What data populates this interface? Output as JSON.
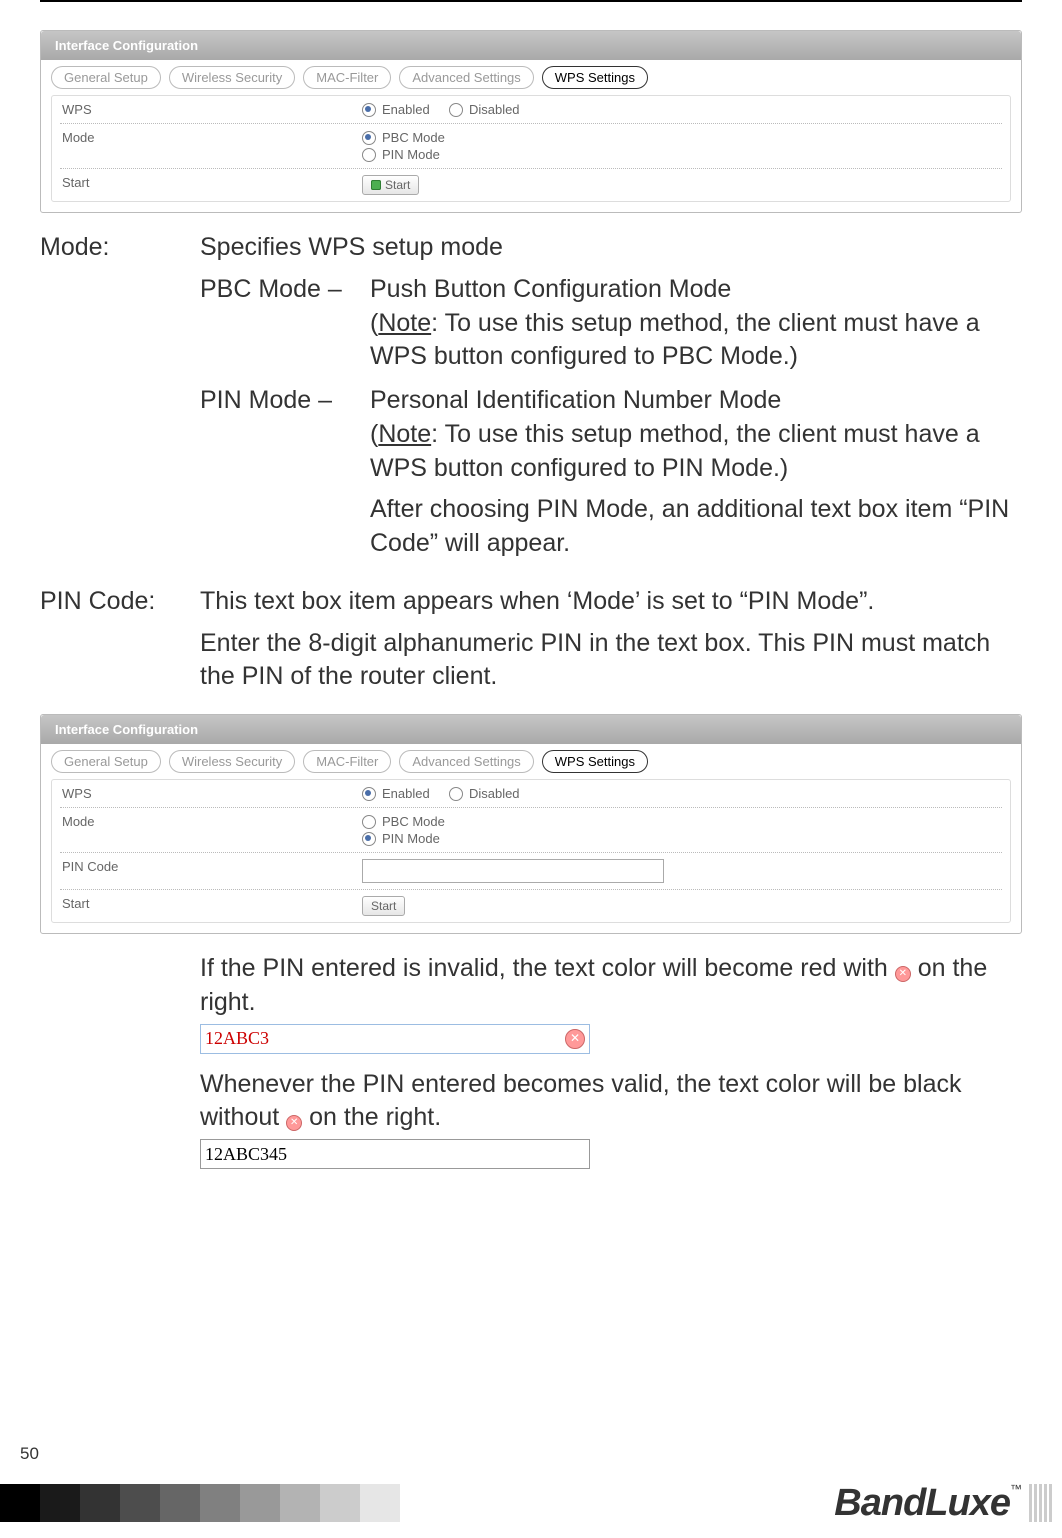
{
  "panel1": {
    "title": "Interface Configuration",
    "tabs": [
      "General Setup",
      "Wireless Security",
      "MAC-Filter",
      "Advanced Settings",
      "WPS Settings"
    ],
    "activeTab": 4,
    "rows": {
      "wps": {
        "label": "WPS",
        "opt_enabled": "Enabled",
        "opt_disabled": "Disabled",
        "selected": "enabled"
      },
      "mode": {
        "label": "Mode",
        "opt_pbc": "PBC Mode",
        "opt_pin": "PIN Mode",
        "selected": "pbc"
      },
      "start": {
        "label": "Start",
        "btn": "Start"
      }
    }
  },
  "body": {
    "mode_term": "Mode:",
    "mode_desc": "Specifies WPS setup mode",
    "pbc_term": "PBC Mode –",
    "pbc_title": "Push Button Configuration Mode",
    "pbc_note_label": "Note",
    "pbc_note_rest": ":    To use this setup method, the client must have a WPS button configured to PBC Mode.)",
    "pin_term": "PIN Mode –",
    "pin_title": "Personal Identification Number Mode",
    "pin_note_label": "Note",
    "pin_note_rest": ":    To use this setup method, the client must have a WPS button configured to PIN Mode.)",
    "pin_extra": "After choosing PIN Mode, an additional text box item “PIN Code” will appear.",
    "pincode_term": "PIN Code:",
    "pincode_p1": "This text box item appears when ‘Mode’ is set to “PIN Mode”.",
    "pincode_p2": "Enter the 8-digit alphanumeric PIN in the text box. This PIN must match the PIN of the router client."
  },
  "panel2": {
    "title": "Interface Configuration",
    "tabs": [
      "General Setup",
      "Wireless Security",
      "MAC-Filter",
      "Advanced Settings",
      "WPS Settings"
    ],
    "activeTab": 4,
    "rows": {
      "wps": {
        "label": "WPS",
        "opt_enabled": "Enabled",
        "opt_disabled": "Disabled",
        "selected": "enabled"
      },
      "mode": {
        "label": "Mode",
        "opt_pbc": "PBC Mode",
        "opt_pin": "PIN Mode",
        "selected": "pin"
      },
      "pincode": {
        "label": "PIN Code"
      },
      "start": {
        "label": "Start",
        "btn": "Start"
      }
    }
  },
  "body2": {
    "invalid_text_a": "If the PIN entered is invalid, the text color will become red with ",
    "invalid_text_b": " on the right.",
    "invalid_sample": "12ABC3",
    "valid_text_a": "Whenever the PIN entered becomes valid, the text color will be black without ",
    "valid_text_b": " on the right.",
    "valid_sample": "12ABC345"
  },
  "footer": {
    "page": "50",
    "brand": "BandLuxe"
  }
}
